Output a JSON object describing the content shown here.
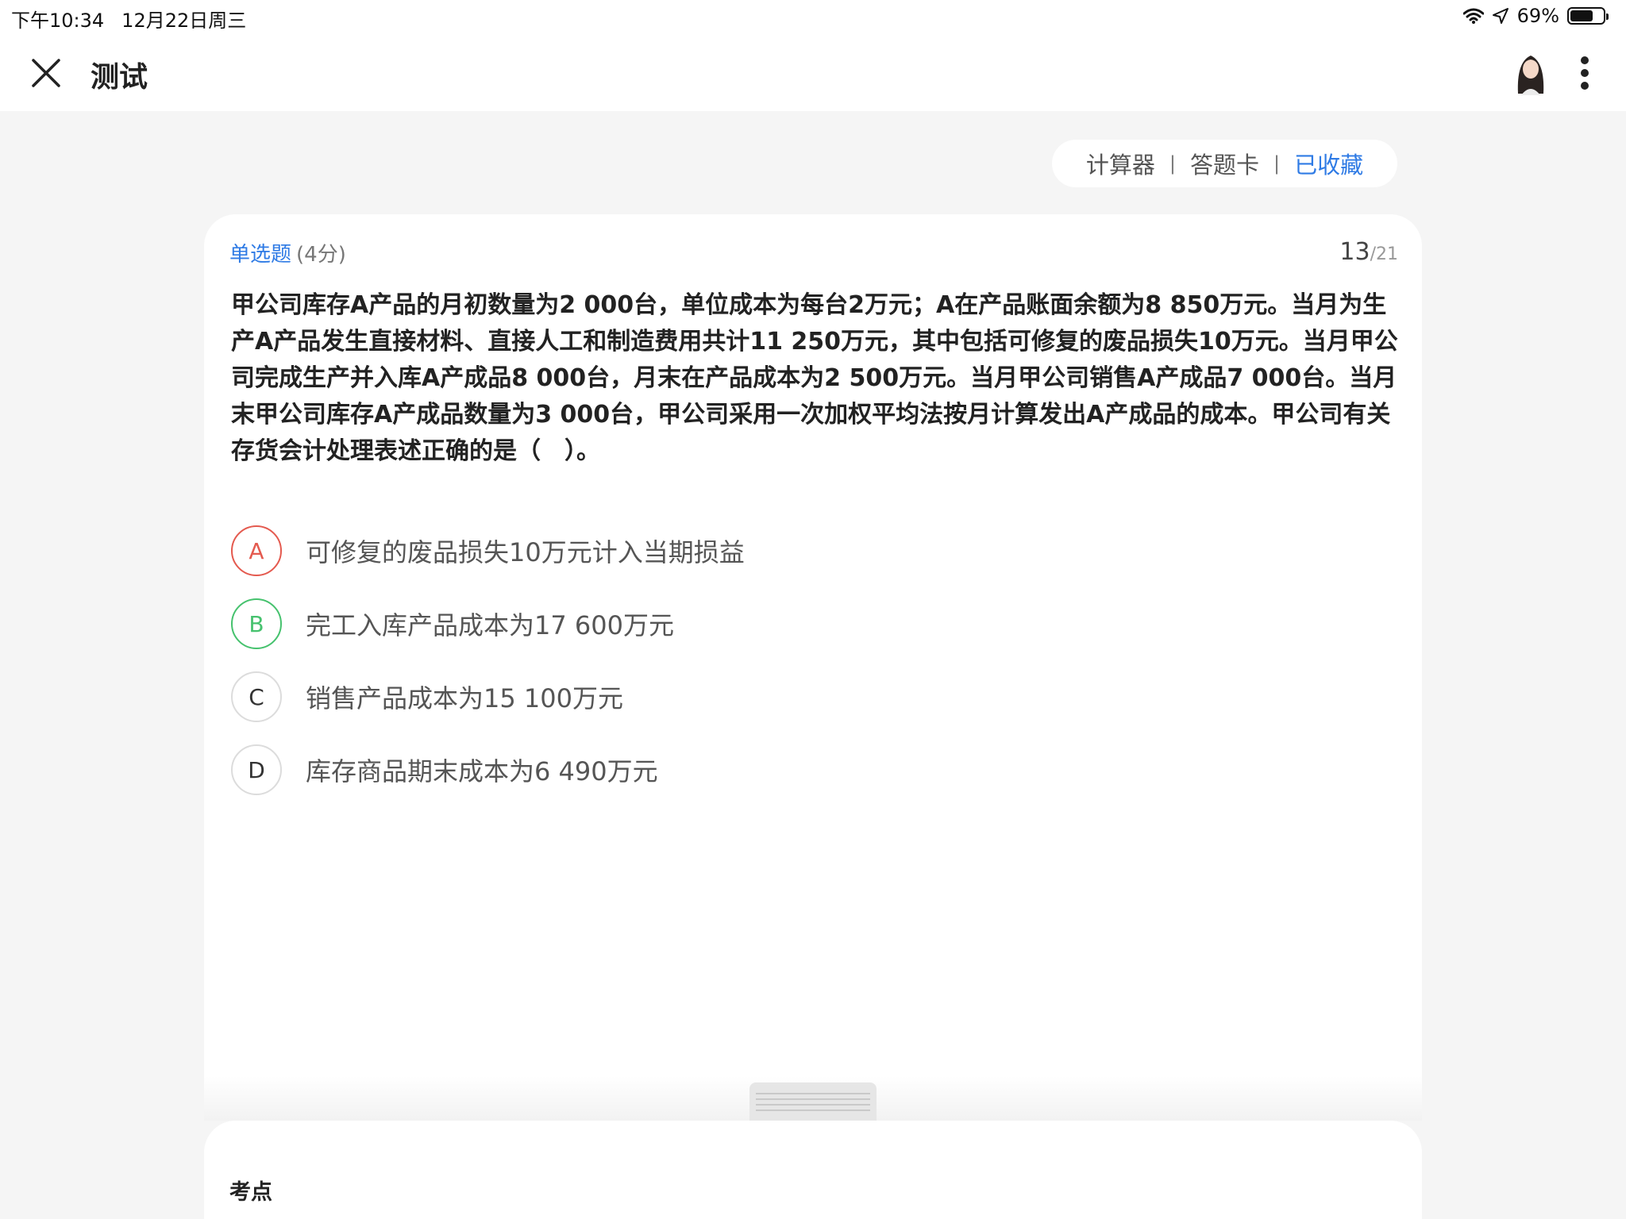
{
  "status_bar": {
    "time": "下午10:34",
    "date": "12月22日周三",
    "battery_percent": "69%",
    "battery_level": 0.69
  },
  "nav": {
    "title": "测试",
    "close_icon": "close-icon",
    "more_icon": "more-vertical-icon",
    "avatar_icon": "user-avatar"
  },
  "toolbar": {
    "calculator": "计算器",
    "answer_card": "答题卡",
    "favorited": "已收藏",
    "separator": "|",
    "favorited_color": "#2f7be5"
  },
  "question": {
    "type": "单选题",
    "score": "(4分)",
    "current": "13",
    "total": "/21",
    "stem": "甲公司库存A产品的月初数量为2 000台，单位成本为每台2万元；A在产品账面余额为8 850万元。当月为生产A产品发生直接材料、直接人工和制造费用共计11 250万元，其中包括可修复的废品损失10万元。当月甲公司完成生产并入库A产成品8 000台，月末在产品成本为2 500万元。当月甲公司销售A产成品7 000台。当月末甲公司库存A产成品数量为3 000台，甲公司采用一次加权平均法按月计算发出A产成品的成本。甲公司有关存货会计处理表述正确的是（　）。",
    "options": [
      {
        "letter": "A",
        "text": "可修复的废品损失10万元计入当期损益",
        "state": "wrong"
      },
      {
        "letter": "B",
        "text": "完工入库产品成本为17 600万元",
        "state": "correct"
      },
      {
        "letter": "C",
        "text": "销售产品成本为15 100万元",
        "state": "normal"
      },
      {
        "letter": "D",
        "text": "库存商品期末成本为6 490万元",
        "state": "normal"
      }
    ]
  },
  "analysis": {
    "title": "考点"
  },
  "colors": {
    "accent": "#2f7be5",
    "wrong": "#e45a4f",
    "correct": "#46c26e",
    "background": "#f5f5f5"
  }
}
